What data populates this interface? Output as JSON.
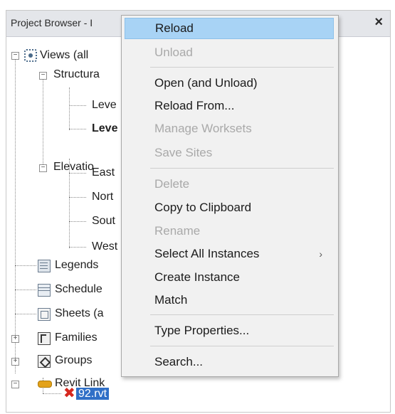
{
  "panel": {
    "title": "Project Browser - I",
    "close_label": "×"
  },
  "tree": {
    "views_label": "Views (all",
    "structural_label": "Structura",
    "level1_label": "Leve",
    "level2_label": "Leve",
    "elevations_label": "Elevatio",
    "east_label": "East",
    "north_label": "Nort",
    "south_label": "Sout",
    "west_label": "West",
    "legends_label": "Legends",
    "schedules_label": "Schedule",
    "sheets_label": "Sheets (a",
    "families_label": "Families",
    "groups_label": "Groups",
    "revit_links_label": "Revit Link",
    "selected_link_label": "92.rvt"
  },
  "context_menu": {
    "reload": "Reload",
    "unload": "Unload",
    "open_and_unload": "Open (and Unload)",
    "reload_from": "Reload From...",
    "manage_worksets": "Manage Worksets",
    "save_sites": "Save Sites",
    "delete": "Delete",
    "copy_to_clipboard": "Copy to Clipboard",
    "rename": "Rename",
    "select_all_instances": "Select All Instances",
    "submenu_arrow": "›",
    "create_instance": "Create Instance",
    "match": "Match",
    "type_properties": "Type Properties...",
    "search": "Search..."
  },
  "colors": {
    "highlight": "#a8d3f5",
    "selection": "#2f6fc7",
    "error_icon": "#d6281f",
    "link_icon": "#e3a21a"
  }
}
